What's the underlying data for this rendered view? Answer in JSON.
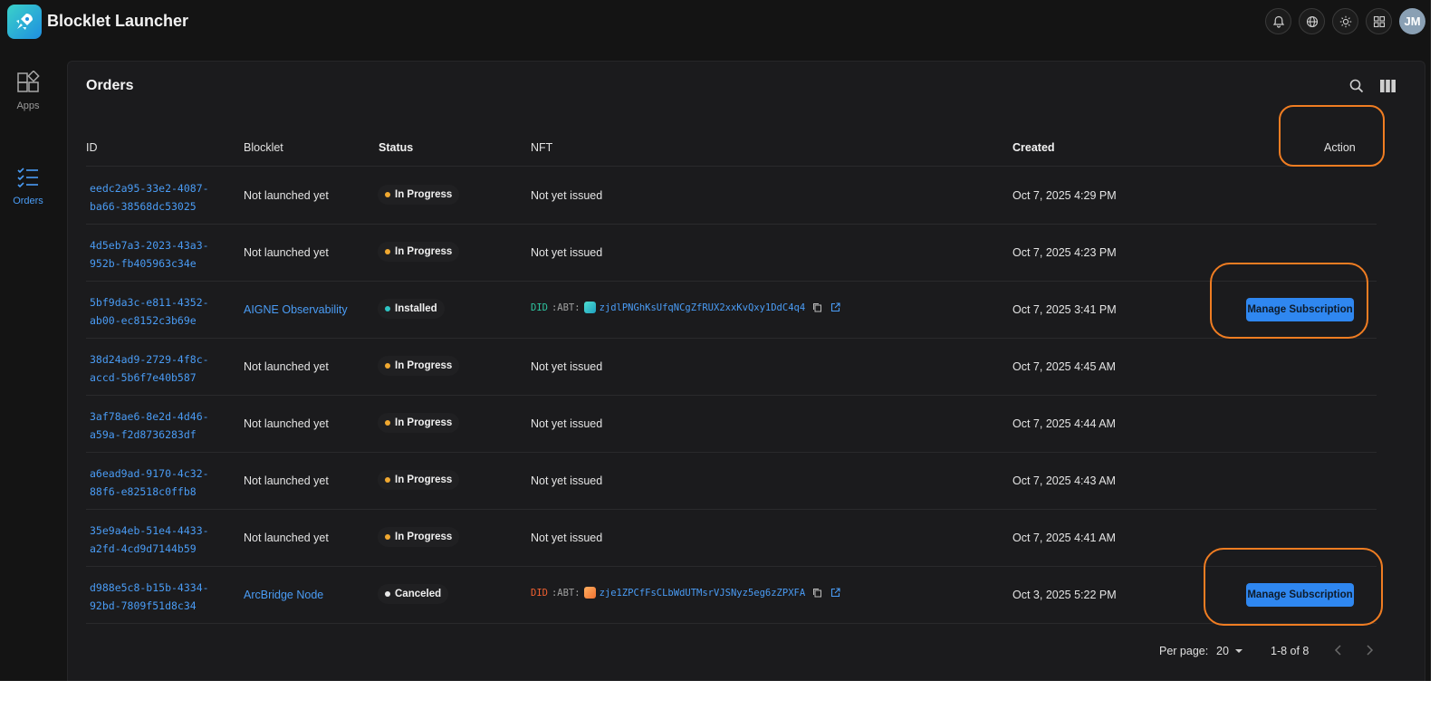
{
  "app": {
    "title": "Blocklet Launcher",
    "avatar_initials": "JM",
    "accent": "#4a9cf5",
    "highlight": "#f07d22"
  },
  "topbar_icons": [
    "bell-icon",
    "globe-icon",
    "theme-toggle-icon",
    "apps-grid-icon"
  ],
  "sidebar": {
    "items": [
      {
        "label": "Apps",
        "icon": "apps-icon",
        "active": false
      },
      {
        "label": "Orders",
        "icon": "checklist-icon",
        "active": true
      }
    ]
  },
  "panel": {
    "title": "Orders",
    "tools": [
      "search-icon",
      "columns-icon"
    ]
  },
  "table": {
    "columns": [
      "ID",
      "Blocklet",
      "Status",
      "NFT",
      "Created",
      "Action"
    ],
    "rows": [
      {
        "id1": "eedc2a95-33e2-4087-",
        "id2": "ba66-38568dc53025",
        "blocklet": "Not launched yet",
        "status": "In Progress",
        "nft": "Not yet issued",
        "created": "Oct 7, 2025 4:29 PM"
      },
      {
        "id1": "4d5eb7a3-2023-43a3-",
        "id2": "952b-fb405963c34e",
        "blocklet": "Not launched yet",
        "status": "In Progress",
        "nft": "Not yet issued",
        "created": "Oct 7, 2025 4:23 PM"
      },
      {
        "id1": "5bf9da3c-e811-4352-",
        "id2": "ab00-ec8152c3b69e",
        "blocklet": "AIGNE Observability",
        "status": "Installed",
        "did_prefix": "DID",
        "did_sep": ":ABT:",
        "did": "zjdlPNGhKsUfqNCgZfRUX2xxKvQxy1DdC4q4",
        "created": "Oct 7, 2025 3:41 PM",
        "action": "Manage Subscription"
      },
      {
        "id1": "38d24ad9-2729-4f8c-",
        "id2": "accd-5b6f7e40b587",
        "blocklet": "Not launched yet",
        "status": "In Progress",
        "nft": "Not yet issued",
        "created": "Oct 7, 2025 4:45 AM"
      },
      {
        "id1": "3af78ae6-8e2d-4d46-",
        "id2": "a59a-f2d8736283df",
        "blocklet": "Not launched yet",
        "status": "In Progress",
        "nft": "Not yet issued",
        "created": "Oct 7, 2025 4:44 AM"
      },
      {
        "id1": "a6ead9ad-9170-4c32-",
        "id2": "88f6-e82518c0ffb8",
        "blocklet": "Not launched yet",
        "status": "In Progress",
        "nft": "Not yet issued",
        "created": "Oct 7, 2025 4:43 AM"
      },
      {
        "id1": "35e9a4eb-51e4-4433-",
        "id2": "a2fd-4cd9d7144b59",
        "blocklet": "Not launched yet",
        "status": "In Progress",
        "nft": "Not yet issued",
        "created": "Oct 7, 2025 4:41 AM"
      },
      {
        "id1": "d988e5c8-b15b-4334-",
        "id2": "92bd-7809f51d8c34",
        "blocklet": "ArcBridge Node",
        "status": "Canceled",
        "did_prefix": "DID",
        "did_sep": ":ABT:",
        "did": "zje1ZPCfFsCLbWdUTMsrVJSNyz5eg6zZPXFA",
        "created": "Oct 3, 2025 5:22 PM",
        "action": "Manage Subscription"
      }
    ]
  },
  "status_colors": {
    "In Progress": "#f0a830",
    "Installed": "#2ec4c4",
    "Canceled": "#e8e8e8"
  },
  "pagination": {
    "per_page_label": "Per page:",
    "per_page_value": "20",
    "range": "1-8 of 8"
  }
}
